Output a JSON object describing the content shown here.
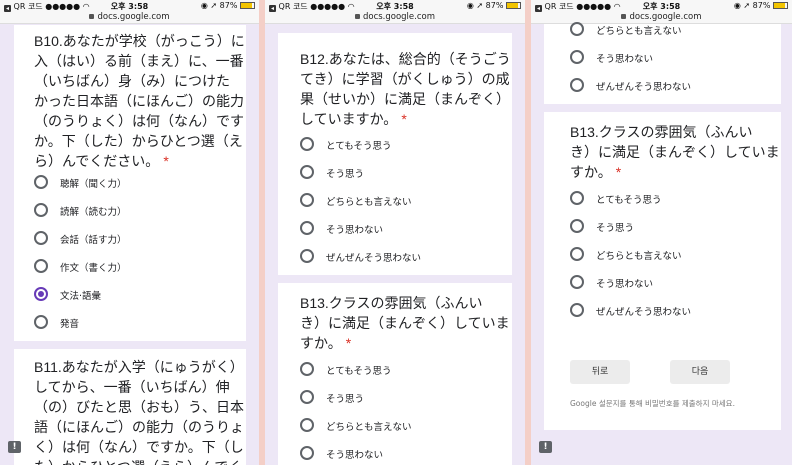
{
  "status_bar": {
    "carrier": "QR 코드 ●●●●● ",
    "time": "오후 3:58",
    "right": "◉ ➚ 87%",
    "url": "docs.google.com"
  },
  "panels": [
    {
      "questions": [
        {
          "text": "B10.あなたが学校（がっこう）に\n入（はい）る前（まえ）に、一番\n（いちばん）身（み）につけた\nかった日本語（にほんご）の能力\n（のうりょく）は何（なん）です\nか。下（した）からひとつ選（え\nら）んでください。",
          "required": "*",
          "options": [
            {
              "label": "聴解（聞く力）",
              "selected": false
            },
            {
              "label": "読解（読む力）",
              "selected": false
            },
            {
              "label": "会話（話す力）",
              "selected": false
            },
            {
              "label": "作文（書く力）",
              "selected": false
            },
            {
              "label": "文法‧語彙",
              "selected": true
            },
            {
              "label": "発音",
              "selected": false
            }
          ]
        },
        {
          "text": "B11.あなたが入学（にゅうがく）\nしてから、一番（いちばん）伸\n（の）びたと思（おも）う、日本\n語（にほんご）の能力（のうりょ\nく）は何（なん）ですか。下（し\nた）からひとつ選（えら）んでく"
        }
      ]
    },
    {
      "questions": [
        {
          "text": "B12.あなたは、総合的（そうごう\nてき）に学習（がくしゅう）の成\n果（せいか）に満足（まんぞく）\nしていますか。",
          "required": "*",
          "options": [
            {
              "label": "とてもそう思う"
            },
            {
              "label": "そう思う"
            },
            {
              "label": "どちらとも言えない"
            },
            {
              "label": "そう思わない"
            },
            {
              "label": "ぜんぜんそう思わない"
            }
          ]
        },
        {
          "text": "B13.クラスの雰囲気（ふんい\nき）に満足（まんぞく）していま\nすか。",
          "required": "*",
          "options": [
            {
              "label": "とてもそう思う"
            },
            {
              "label": "そう思う"
            },
            {
              "label": "どちらとも言えない"
            },
            {
              "label": "そう思わない"
            }
          ]
        }
      ]
    },
    {
      "top_options": [
        {
          "label": "どちらとも言えない"
        },
        {
          "label": "そう思わない"
        },
        {
          "label": "ぜんぜんそう思わない"
        }
      ],
      "questions": [
        {
          "text": "B13.クラスの雰囲気（ふんい\nき）に満足（まんぞく）していま\nすか。",
          "required": "*",
          "options": [
            {
              "label": "とてもそう思う"
            },
            {
              "label": "そう思う"
            },
            {
              "label": "どちらとも言えない"
            },
            {
              "label": "そう思わない"
            },
            {
              "label": "ぜんぜんそう思わない"
            }
          ]
        }
      ],
      "back_button": "뒤로",
      "next_button": "다음",
      "footer": "Google 설문지를 통해 비밀번호를 제출하지 마세요."
    }
  ],
  "feedback_icon": "feedback-icon",
  "colors": {
    "accent": "#673ab7",
    "required": "#d93025",
    "page_bg": "#ede7f6",
    "divider": "#f4cfc7"
  }
}
